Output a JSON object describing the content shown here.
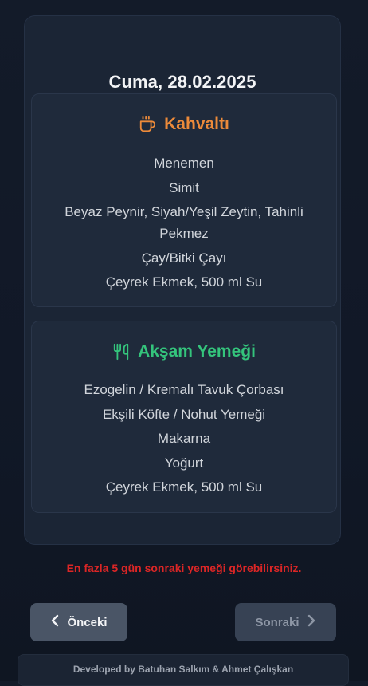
{
  "day": {
    "title": "Cuma, 28.02.2025"
  },
  "breakfast": {
    "title": "Kahvaltı",
    "icon": "coffee-cup-icon",
    "color": "#ec8a3a",
    "items": [
      "Menemen",
      "Simit",
      "Beyaz Peynir, Siyah/Yeşil Zeytin, Tahinli Pekmez",
      "Çay/Bitki Çayı",
      "Çeyrek Ekmek, 500 ml Su"
    ]
  },
  "dinner": {
    "title": "Akşam Yemeği",
    "icon": "fork-knife-icon",
    "color": "#34c47c",
    "items": [
      "Ezogelin / Kremalı Tavuk Çorbası",
      "Ekşili Köfte / Nohut Yemeği",
      "Makarna",
      "Yoğurt",
      "Çeyrek Ekmek, 500 ml Su"
    ]
  },
  "notice": {
    "text": "En fazla 5 gün sonraki yemeği görebilirsiniz.",
    "color": "#dc2626"
  },
  "nav": {
    "prev_label": "Önceki",
    "next_label": "Sonraki",
    "prev_icon": "chevron-left-icon",
    "next_icon": "chevron-right-icon"
  },
  "footer": {
    "text": "Developed by Batuhan Salkım & Ahmet Çalışkan"
  }
}
